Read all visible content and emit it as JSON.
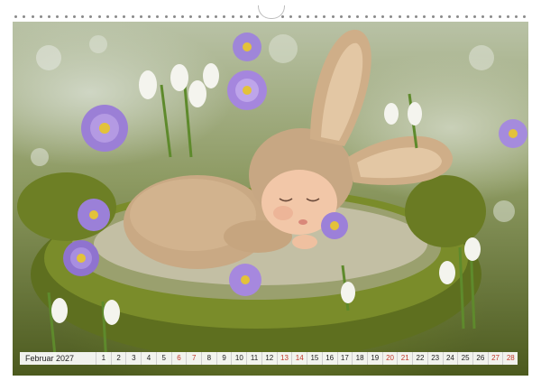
{
  "calendar": {
    "month_label": "Februar 2027",
    "days": [
      {
        "n": "1",
        "weekend": false
      },
      {
        "n": "2",
        "weekend": false
      },
      {
        "n": "3",
        "weekend": false
      },
      {
        "n": "4",
        "weekend": false
      },
      {
        "n": "5",
        "weekend": false
      },
      {
        "n": "6",
        "weekend": true
      },
      {
        "n": "7",
        "weekend": true
      },
      {
        "n": "8",
        "weekend": false
      },
      {
        "n": "9",
        "weekend": false
      },
      {
        "n": "10",
        "weekend": false
      },
      {
        "n": "11",
        "weekend": false
      },
      {
        "n": "12",
        "weekend": false
      },
      {
        "n": "13",
        "weekend": true
      },
      {
        "n": "14",
        "weekend": true
      },
      {
        "n": "15",
        "weekend": false
      },
      {
        "n": "16",
        "weekend": false
      },
      {
        "n": "17",
        "weekend": false
      },
      {
        "n": "18",
        "weekend": false
      },
      {
        "n": "19",
        "weekend": false
      },
      {
        "n": "20",
        "weekend": true
      },
      {
        "n": "21",
        "weekend": true
      },
      {
        "n": "22",
        "weekend": false
      },
      {
        "n": "23",
        "weekend": false
      },
      {
        "n": "24",
        "weekend": false
      },
      {
        "n": "25",
        "weekend": false
      },
      {
        "n": "26",
        "weekend": false
      },
      {
        "n": "27",
        "weekend": true
      },
      {
        "n": "28",
        "weekend": true
      }
    ]
  },
  "colors": {
    "weekend": "#c0392b",
    "weekday": "#222222",
    "moss": "#6b7d24",
    "knit": "#c8a882",
    "crocus": "#9b7fd6",
    "snowdrop": "#f4f4ee"
  },
  "photo": {
    "icons": [
      "sleeping-baby-in-bunny-costume",
      "moss-nest",
      "purple-crocus-flower",
      "snowdrop-flower"
    ]
  }
}
